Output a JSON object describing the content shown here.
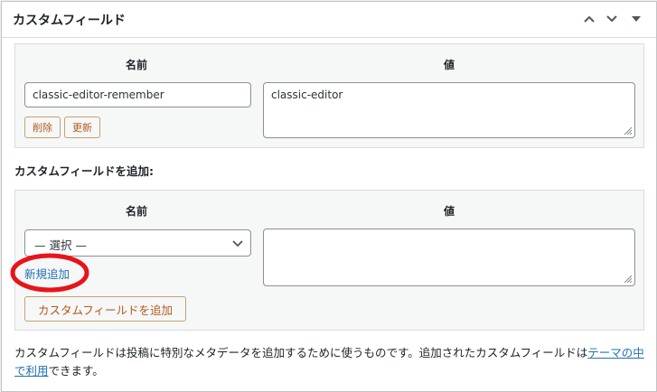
{
  "box": {
    "title": "カスタムフィールド",
    "icons": [
      "chevron-up-icon",
      "chevron-down-icon",
      "triangle-down-icon"
    ]
  },
  "existing": {
    "col_name": "名前",
    "col_value": "値",
    "name_value": "classic-editor-remember",
    "value_value": "classic-editor",
    "delete_label": "削除",
    "update_label": "更新"
  },
  "add_new": {
    "section_label": "カスタムフィールドを追加:",
    "col_name": "名前",
    "col_value": "値",
    "select_value": "— 選択 —",
    "new_link": "新規追加",
    "add_button": "カスタムフィールドを追加",
    "value_text": ""
  },
  "help": {
    "text_before": "カスタムフィールドは投稿に特別なメタデータを追加するために使うものです。追加されたカスタムフィールドは",
    "link_text": "テーマの中で利用",
    "text_after": "できます。"
  },
  "colors": {
    "accent_link": "#2271b1",
    "button_text": "#b35a1f",
    "annotation_red": "#e8141a"
  }
}
